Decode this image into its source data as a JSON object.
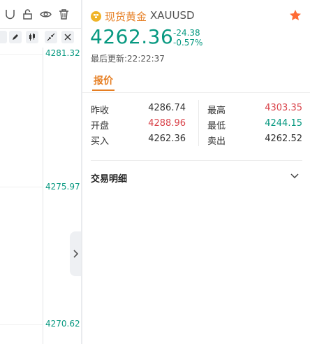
{
  "chart": {
    "price_axis": [
      "4281.32",
      "4275.97",
      "4270.62"
    ],
    "toolbar_icons": [
      "magnet-icon",
      "lock-icon",
      "eye-icon",
      "trash-icon"
    ],
    "tool_buttons": [
      "pencil-icon",
      "candles-icon",
      "shrink-icon",
      "close-icon"
    ]
  },
  "symbol": {
    "name": "现货黄金",
    "code": "XAUUSD",
    "price": "4262.36",
    "change": "-24.38",
    "change_pct": "-0.57%",
    "updated_label": "最后更新:",
    "updated_time": "22:22:37"
  },
  "tabs": [
    {
      "label": "报价",
      "active": true
    }
  ],
  "quote": {
    "rows": [
      {
        "l1": "昨收",
        "v1": "4286.74",
        "l2": "最高",
        "v2": "4303.35"
      },
      {
        "l1": "开盘",
        "v1": "4288.96",
        "l2": "最低",
        "v2": "4244.15"
      },
      {
        "l1": "买入",
        "v1": "4262.36",
        "l2": "卖出",
        "v2": "4262.52"
      }
    ]
  },
  "details": {
    "title": "交易明细"
  },
  "colors": {
    "accent": "#e67e22",
    "down_green": "#089981",
    "up_red": "#d9434a",
    "gold": "#f0b429"
  }
}
